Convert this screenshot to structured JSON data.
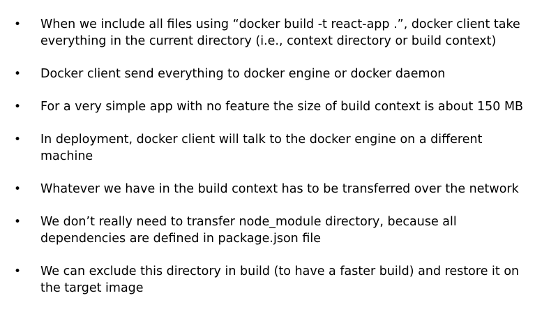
{
  "slide": {
    "bullet_glyph": "•",
    "bullets": [
      {
        "text": "When we include all files using “docker build -t react-app .”, docker client take everything in the current directory (i.e., context directory or build context)"
      },
      {
        "text": "Docker client send everything to docker engine or docker daemon"
      },
      {
        "text": "For a very simple app with no feature the size of build context is about 150 MB"
      },
      {
        "text": "In deployment, docker client will talk to the docker engine on a different machine"
      },
      {
        "text": "Whatever we have in the build context has to be transferred over the network"
      },
      {
        "text": "We don’t really need to transfer node_module directory, because all dependencies are defined in package.json file"
      },
      {
        "text": "We can exclude this directory in build (to have a faster build) and restore it on the target image"
      }
    ]
  }
}
